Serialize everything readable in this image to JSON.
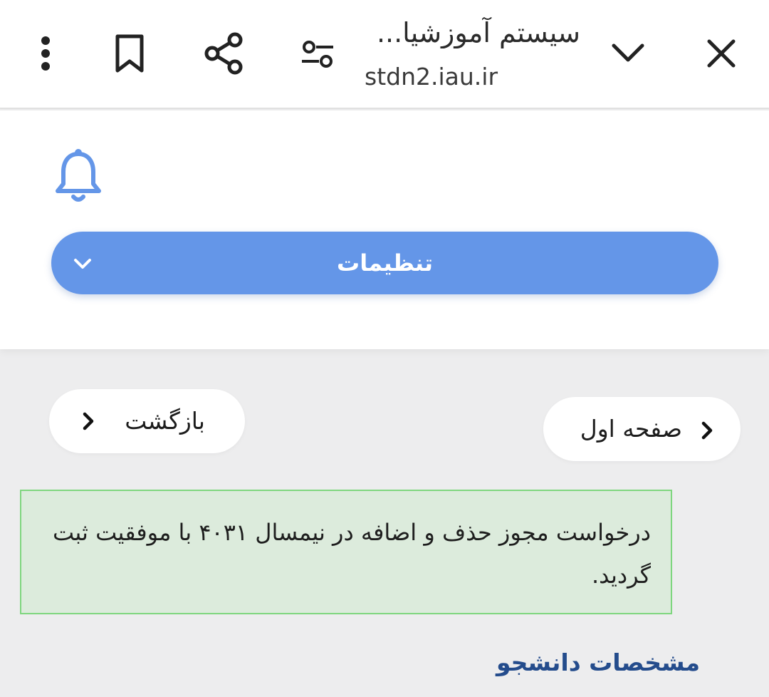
{
  "browser": {
    "page_title": "سیستم آموزشیا...",
    "url": "stdn2.iau.ir",
    "icons": [
      "menu-dots-icon",
      "bookmark-icon",
      "share-icon",
      "tune-icon",
      "chevron-down-icon",
      "close-icon"
    ]
  },
  "header": {
    "notification_icon": "bell-icon",
    "settings_label": "تنظیمات",
    "accent_color": "#6496e8"
  },
  "nav": {
    "back_label": "بازگشت",
    "home_label": "صفحه اول"
  },
  "alert": {
    "message": "درخواست مجوز حذف و اضافه در نیمسال ۴۰۳۱ با موفقیت ثبت گردید.",
    "background_color": "#dcebdc",
    "border_color": "#7fd67f"
  },
  "student_section": {
    "title": "مشخصات دانشجو",
    "title_color": "#244c8c"
  }
}
